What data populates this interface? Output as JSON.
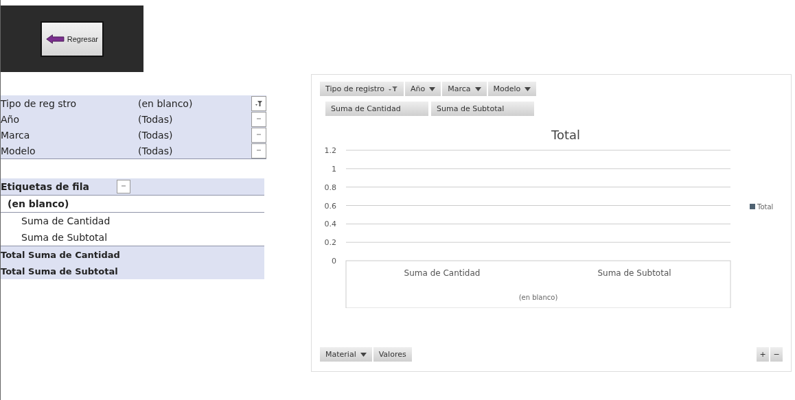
{
  "back_button": {
    "label": "Regresar"
  },
  "report_filters": [
    {
      "field": "Tipo de reg stro",
      "value": "(en blanco)",
      "filtered": true
    },
    {
      "field": "Año",
      "value": "(Todas)",
      "filtered": false
    },
    {
      "field": "Marca",
      "value": "(Todas)",
      "filtered": false
    },
    {
      "field": "Modelo",
      "value": "(Todas)",
      "filtered": false
    }
  ],
  "pivot": {
    "header": "Etiquetas de fila",
    "group": "(en blanco)",
    "items": [
      "Suma de Cantidad",
      "Suma de Subtotal"
    ],
    "totals": [
      "Total Suma de Cantidad",
      "Total Suma de Subtotal"
    ]
  },
  "chart_panel": {
    "filter_buttons": [
      {
        "label": "Tipo de registro",
        "filtered": true
      },
      {
        "label": "Año",
        "filtered": false
      },
      {
        "label": "Marca",
        "filtered": false
      },
      {
        "label": "Modelo",
        "filtered": false
      }
    ],
    "value_buttons": [
      "Suma de Cantidad",
      "Suma de Subtotal"
    ],
    "chart_data": {
      "type": "bar",
      "title": "Total",
      "categories": [
        "Suma de Cantidad",
        "Suma de Subtotal"
      ],
      "xlabel": "(en blanco)",
      "series": [
        {
          "name": "Total",
          "color": "#4f6272",
          "values": [
            null,
            null
          ]
        }
      ],
      "ylim": [
        0,
        1.2
      ],
      "grid": true,
      "yticks": [
        0,
        0.2,
        0.4,
        0.6,
        0.8,
        1,
        1.2
      ]
    },
    "axis_buttons": [
      {
        "label": "Material",
        "dropdown": true
      },
      {
        "label": "Valores",
        "dropdown": false
      }
    ],
    "zoom_buttons": [
      "+",
      "−"
    ]
  }
}
